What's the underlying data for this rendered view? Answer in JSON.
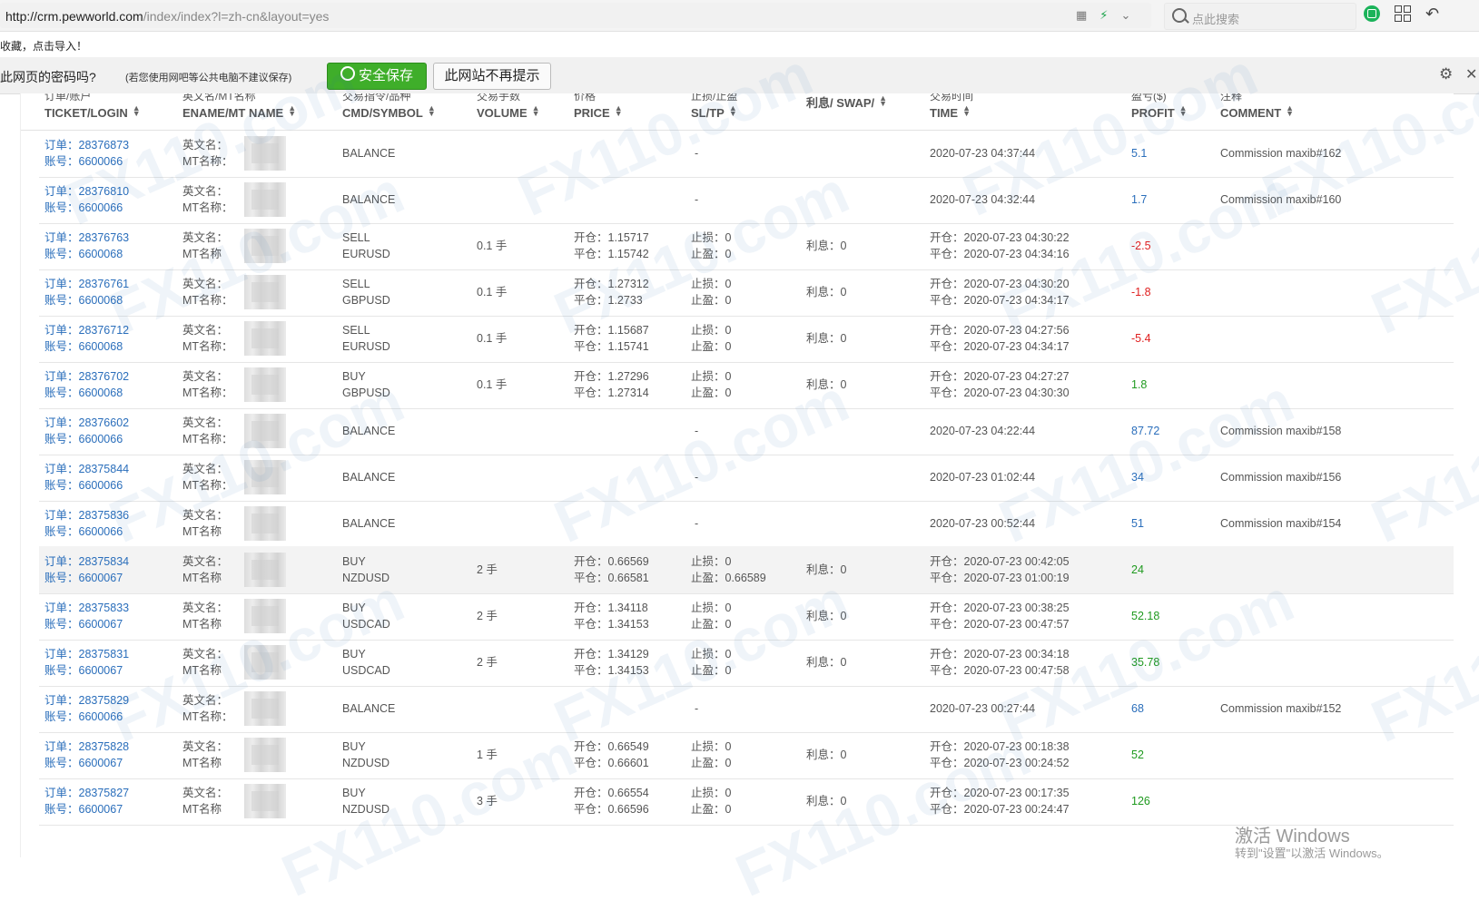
{
  "browser": {
    "url_host": "http://crm.pewworld.com",
    "url_path": "/index/index?l=zh-cn&layout=yes",
    "search_placeholder": "点此搜索"
  },
  "notifications": {
    "bookmark_text": "收藏，点击导入！",
    "password_question": "此网页的密码吗?",
    "password_note": "(若您使用网吧等公共电脑不建议保存)",
    "save_button": "安全保存",
    "never_button": "此网站不再提示"
  },
  "table": {
    "columns": [
      {
        "cn": "订单/账户",
        "en": "TICKET/LOGIN"
      },
      {
        "cn": "英文名/MT名称",
        "en": "ENAME/MT NAME"
      },
      {
        "cn": "交易指令/品种",
        "en": "CMD/SYMBOL"
      },
      {
        "cn": "交易手数",
        "en": "VOLUME"
      },
      {
        "cn": "价格",
        "en": "PRICE"
      },
      {
        "cn": "止损/止盈",
        "en": "SL/TP"
      },
      {
        "cn": "",
        "en": "利息/ SWAP/"
      },
      {
        "cn": "交易时间",
        "en": "TIME"
      },
      {
        "cn": "盈亏($)",
        "en": "PROFIT"
      },
      {
        "cn": "注释",
        "en": "COMMENT"
      }
    ],
    "rows": [
      {
        "ticket": "订单：28376873",
        "login": "账号：6600066",
        "ename": "英文名：",
        "mtname": "MT名称：",
        "cmd": "BALANCE",
        "symbol": "",
        "volume": "",
        "open_price": "",
        "close_price": "",
        "sl": "",
        "tp": "",
        "sltp_dash": "-",
        "swap": "",
        "time_open": "2020-07-23 04:37:44",
        "time_close": "",
        "profit": "5.1",
        "profit_type": "bal",
        "comment": "Commission maxib#162"
      },
      {
        "ticket": "订单：28376810",
        "login": "账号：6600066",
        "ename": "英文名：",
        "mtname": "MT名称：",
        "cmd": "BALANCE",
        "symbol": "",
        "volume": "",
        "open_price": "",
        "close_price": "",
        "sl": "",
        "tp": "",
        "sltp_dash": "-",
        "swap": "",
        "time_open": "2020-07-23 04:32:44",
        "time_close": "",
        "profit": "1.7",
        "profit_type": "bal",
        "comment": "Commission maxib#160"
      },
      {
        "ticket": "订单：28376763",
        "login": "账号：6600068",
        "ename": "英文名：",
        "mtname": "MT名称",
        "cmd": "SELL",
        "symbol": "EURUSD",
        "volume": "0.1 手",
        "open_price": "开仓：1.15717",
        "close_price": "平仓：1.15742",
        "sl": "止损：0",
        "tp": "止盈：0",
        "sltp_dash": "",
        "swap": "利息：0",
        "time_open": "开仓：2020-07-23 04:30:22",
        "time_close": "平仓：2020-07-23 04:34:16",
        "profit": "-2.5",
        "profit_type": "neg",
        "comment": ""
      },
      {
        "ticket": "订单：28376761",
        "login": "账号：6600068",
        "ename": "英文名：",
        "mtname": "MT名称：",
        "cmd": "SELL",
        "symbol": "GBPUSD",
        "volume": "0.1 手",
        "open_price": "开仓：1.27312",
        "close_price": "平仓：1.2733",
        "sl": "止损：0",
        "tp": "止盈：0",
        "sltp_dash": "",
        "swap": "利息：0",
        "time_open": "开仓：2020-07-23 04:30:20",
        "time_close": "平仓：2020-07-23 04:34:17",
        "profit": "-1.8",
        "profit_type": "neg",
        "comment": ""
      },
      {
        "ticket": "订单：28376712",
        "login": "账号：6600068",
        "ename": "英文名：",
        "mtname": "MT名称：",
        "cmd": "SELL",
        "symbol": "EURUSD",
        "volume": "0.1 手",
        "open_price": "开仓：1.15687",
        "close_price": "平仓：1.15741",
        "sl": "止损：0",
        "tp": "止盈：0",
        "sltp_dash": "",
        "swap": "利息：0",
        "time_open": "开仓：2020-07-23 04:27:56",
        "time_close": "平仓：2020-07-23 04:34:17",
        "profit": "-5.4",
        "profit_type": "neg",
        "comment": ""
      },
      {
        "ticket": "订单：28376702",
        "login": "账号：6600068",
        "ename": "英文名：",
        "mtname": "MT名称：",
        "cmd": "BUY",
        "symbol": "GBPUSD",
        "volume": "0.1 手",
        "open_price": "开仓：1.27296",
        "close_price": "平仓：1.27314",
        "sl": "止损：0",
        "tp": "止盈：0",
        "sltp_dash": "",
        "swap": "利息：0",
        "time_open": "开仓：2020-07-23 04:27:27",
        "time_close": "平仓：2020-07-23 04:30:30",
        "profit": "1.8",
        "profit_type": "pos",
        "comment": ""
      },
      {
        "ticket": "订单：28376602",
        "login": "账号：6600066",
        "ename": "英文名：",
        "mtname": "MT名称：",
        "cmd": "BALANCE",
        "symbol": "",
        "volume": "",
        "open_price": "",
        "close_price": "",
        "sl": "",
        "tp": "",
        "sltp_dash": "-",
        "swap": "",
        "time_open": "2020-07-23 04:22:44",
        "time_close": "",
        "profit": "87.72",
        "profit_type": "bal",
        "comment": "Commission maxib#158"
      },
      {
        "ticket": "订单：28375844",
        "login": "账号：6600066",
        "ename": "英文名：",
        "mtname": "MT名称：",
        "cmd": "BALANCE",
        "symbol": "",
        "volume": "",
        "open_price": "",
        "close_price": "",
        "sl": "",
        "tp": "",
        "sltp_dash": "-",
        "swap": "",
        "time_open": "2020-07-23 01:02:44",
        "time_close": "",
        "profit": "34",
        "profit_type": "bal",
        "comment": "Commission maxib#156"
      },
      {
        "ticket": "订单：28375836",
        "login": "账号：6600066",
        "ename": "英文名：",
        "mtname": "MT名称",
        "cmd": "BALANCE",
        "symbol": "",
        "volume": "",
        "open_price": "",
        "close_price": "",
        "sl": "",
        "tp": "",
        "sltp_dash": "-",
        "swap": "",
        "time_open": "2020-07-23 00:52:44",
        "time_close": "",
        "profit": "51",
        "profit_type": "bal",
        "comment": "Commission maxib#154"
      },
      {
        "ticket": "订单：28375834",
        "login": "账号：6600067",
        "ename": "英文名：",
        "mtname": "MT名称",
        "cmd": "BUY",
        "symbol": "NZDUSD",
        "volume": "2 手",
        "open_price": "开仓：0.66569",
        "close_price": "平仓：0.66581",
        "sl": "止损：0",
        "tp": "止盈：0.66589",
        "sltp_dash": "",
        "swap": "利息：0",
        "time_open": "开仓：2020-07-23 00:42:05",
        "time_close": "平仓：2020-07-23 01:00:19",
        "profit": "24",
        "profit_type": "pos",
        "comment": "",
        "highlight": true
      },
      {
        "ticket": "订单：28375833",
        "login": "账号：6600067",
        "ename": "英文名：",
        "mtname": "MT名称",
        "cmd": "BUY",
        "symbol": "USDCAD",
        "volume": "2 手",
        "open_price": "开仓：1.34118",
        "close_price": "平仓：1.34153",
        "sl": "止损：0",
        "tp": "止盈：0",
        "sltp_dash": "",
        "swap": "利息：0",
        "time_open": "开仓：2020-07-23 00:38:25",
        "time_close": "平仓：2020-07-23 00:47:57",
        "profit": "52.18",
        "profit_type": "pos",
        "comment": ""
      },
      {
        "ticket": "订单：28375831",
        "login": "账号：6600067",
        "ename": "英文名：",
        "mtname": "MT名称",
        "cmd": "BUY",
        "symbol": "USDCAD",
        "volume": "2 手",
        "open_price": "开仓：1.34129",
        "close_price": "平仓：1.34153",
        "sl": "止损：0",
        "tp": "止盈：0",
        "sltp_dash": "",
        "swap": "利息：0",
        "time_open": "开仓：2020-07-23 00:34:18",
        "time_close": "平仓：2020-07-23 00:47:58",
        "profit": "35.78",
        "profit_type": "pos",
        "comment": ""
      },
      {
        "ticket": "订单：28375829",
        "login": "账号：6600066",
        "ename": "英文名：",
        "mtname": "MT名称：",
        "cmd": "BALANCE",
        "symbol": "",
        "volume": "",
        "open_price": "",
        "close_price": "",
        "sl": "",
        "tp": "",
        "sltp_dash": "-",
        "swap": "",
        "time_open": "2020-07-23 00:27:44",
        "time_close": "",
        "profit": "68",
        "profit_type": "bal",
        "comment": "Commission maxib#152"
      },
      {
        "ticket": "订单：28375828",
        "login": "账号：6600067",
        "ename": "英文名：",
        "mtname": "MT名称",
        "cmd": "BUY",
        "symbol": "NZDUSD",
        "volume": "1 手",
        "open_price": "开仓：0.66549",
        "close_price": "平仓：0.66601",
        "sl": "止损：0",
        "tp": "止盈：0",
        "sltp_dash": "",
        "swap": "利息：0",
        "time_open": "开仓：2020-07-23 00:18:38",
        "time_close": "平仓：2020-07-23 00:24:52",
        "profit": "52",
        "profit_type": "pos",
        "comment": ""
      },
      {
        "ticket": "订单：28375827",
        "login": "账号：6600067",
        "ename": "英文名：",
        "mtname": "MT名称",
        "cmd": "BUY",
        "symbol": "NZDUSD",
        "volume": "3 手",
        "open_price": "开仓：0.66554",
        "close_price": "平仓：0.66596",
        "sl": "止损：0",
        "tp": "止盈：0",
        "sltp_dash": "",
        "swap": "利息：0",
        "time_open": "开仓：2020-07-23 00:17:35",
        "time_close": "平仓：2020-07-23 00:24:47",
        "profit": "126",
        "profit_type": "pos",
        "comment": ""
      }
    ]
  },
  "watermark": {
    "site": "FX110.com",
    "windows_line1": "激活 Windows",
    "windows_line2": "转到\"设置\"以激活 Windows。"
  },
  "colors": {
    "link": "#2a6ebb",
    "negative": "#e02020",
    "positive": "#1f9a1f",
    "save_button": "#3fae2a"
  }
}
